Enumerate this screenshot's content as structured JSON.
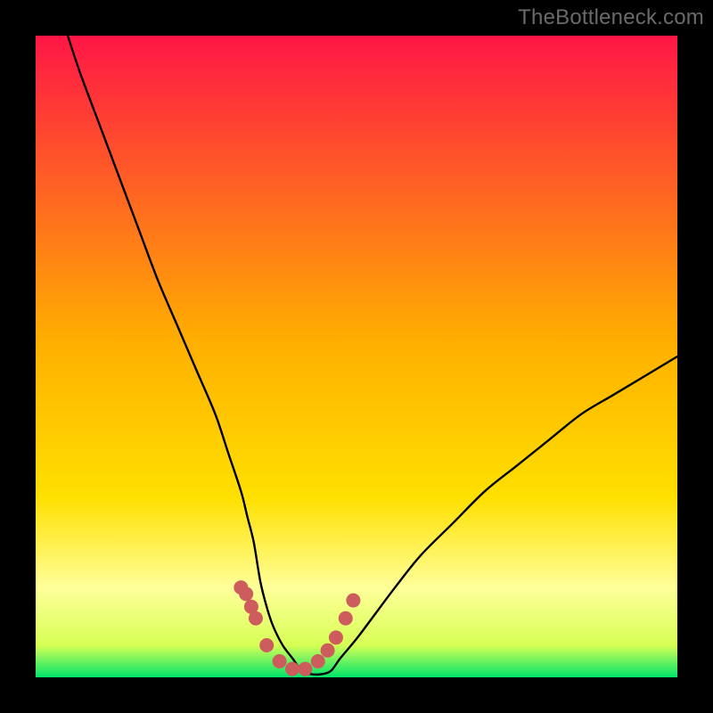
{
  "watermark": "TheBottleneck.com",
  "chart_data": {
    "type": "line",
    "title": "",
    "xlabel": "",
    "ylabel": "",
    "xlim": [
      0,
      100
    ],
    "ylim": [
      0,
      100
    ],
    "grid": false,
    "legend": false,
    "gradient_colors": {
      "top": "#ff1646",
      "mid": "#ffd400",
      "bottom_band": "#ffff9a",
      "bottom": "#00e56a"
    },
    "series": [
      {
        "name": "bottleneck-curve",
        "color": "#000000",
        "x": [
          5,
          7,
          10,
          13,
          16,
          19,
          22,
          25,
          28,
          30,
          32,
          33,
          34,
          35,
          36,
          37,
          38.5,
          40,
          41.5,
          43,
          44.5,
          46,
          47.5,
          50,
          53,
          56,
          60,
          65,
          70,
          75,
          80,
          85,
          90,
          95,
          100
        ],
        "values": [
          100,
          94,
          86,
          78,
          70,
          62,
          55,
          48,
          41,
          35,
          29,
          25,
          21,
          15,
          11,
          8,
          5,
          3,
          1,
          0.5,
          0.5,
          1,
          3,
          6,
          10,
          14,
          19,
          24,
          29,
          33,
          37,
          41,
          44,
          47,
          50
        ]
      },
      {
        "name": "highlight-dots",
        "color": "#cd5c5c",
        "x": [
          32.0,
          32.8,
          33.6,
          34.3,
          36.0,
          38.0,
          40.0,
          42.0,
          44.0,
          45.5,
          46.8,
          48.3,
          49.5
        ],
        "values": [
          14.0,
          13.0,
          11.0,
          9.2,
          5.0,
          2.5,
          1.3,
          1.3,
          2.5,
          4.2,
          6.2,
          9.2,
          12.0
        ]
      }
    ]
  }
}
